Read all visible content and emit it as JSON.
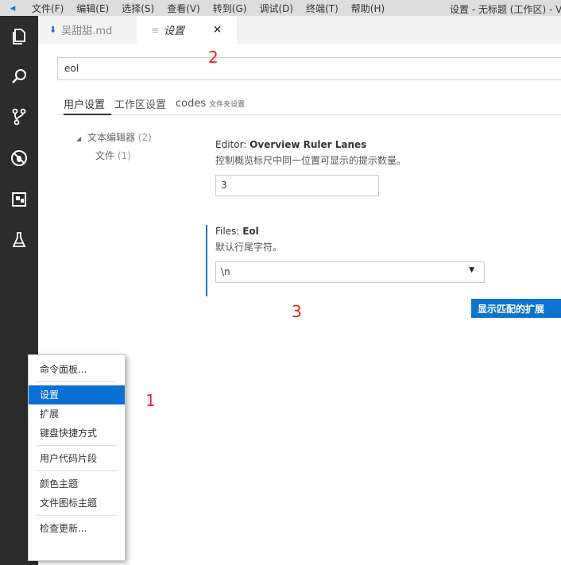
{
  "menubar": {
    "logo_glyph": "◂",
    "items": [
      "文件(F)",
      "编辑(E)",
      "选择(S)",
      "查看(V)",
      "转到(G)",
      "调试(D)",
      "终端(T)",
      "帮助(H)"
    ],
    "window_title": "设置 - 无标题 (工作区) - V"
  },
  "activity_icons": [
    "files-icon",
    "search-icon",
    "source-control-icon",
    "debug-icon",
    "extensions-icon",
    "flask-icon"
  ],
  "tabs": [
    {
      "label": "吴甜甜.md",
      "icon": "markdown-icon"
    },
    {
      "label": "设置",
      "icon": "settings-lines-icon",
      "close": "×"
    }
  ],
  "search": {
    "value": "eol"
  },
  "settings_tabs": {
    "user": "用户设置",
    "workspace": "工作区设置",
    "folder": "codes",
    "folder_note": "文件夹设置"
  },
  "toc": {
    "group_arrow": "◢",
    "group": "文本编辑器",
    "group_count": "(2)",
    "child": "文件",
    "child_count": "(1)"
  },
  "settings": [
    {
      "title_prefix": "Editor: ",
      "title_name": "Overview Ruler Lanes",
      "description": "控制概览标尺中同一位置可显示的提示数量。",
      "value": "3"
    },
    {
      "title_prefix": "Files: ",
      "title_name": "Eol",
      "description": "默认行尾字符。",
      "value": "\\n",
      "caret": "▼"
    }
  ],
  "show_extensions_button": "显示匹配的扩展",
  "annotations": [
    "1",
    "2",
    "3"
  ],
  "context_menu": {
    "items": [
      "命令面板...",
      "设置",
      "扩展",
      "键盘快捷方式",
      "用户代码片段",
      "颜色主题",
      "文件图标主题",
      "检查更新..."
    ],
    "selected": "设置"
  },
  "colors": {
    "accent": "#0a70d4",
    "activity_bar": "#2c2c2c",
    "annotation": "#e0271f"
  }
}
